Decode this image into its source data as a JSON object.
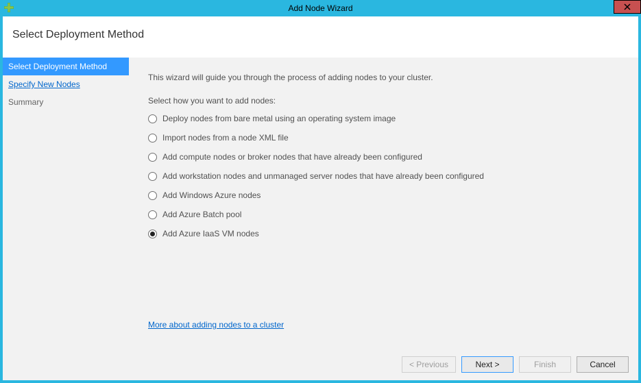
{
  "window": {
    "title": "Add Node Wizard"
  },
  "header": {
    "title": "Select Deployment Method"
  },
  "sidebar": {
    "items": [
      {
        "label": "Select Deployment Method",
        "state": "active"
      },
      {
        "label": "Specify New Nodes",
        "state": "link"
      },
      {
        "label": "Summary",
        "state": "normal"
      }
    ]
  },
  "content": {
    "intro": "This wizard will guide you through the process of adding nodes to your cluster.",
    "prompt": "Select how you want to add nodes:",
    "options": [
      {
        "label": "Deploy nodes from bare metal using an operating system image",
        "selected": false
      },
      {
        "label": "Import nodes from a node XML file",
        "selected": false
      },
      {
        "label": "Add compute nodes or broker nodes that have already been configured",
        "selected": false
      },
      {
        "label": "Add workstation nodes and unmanaged server nodes that have already been configured",
        "selected": false
      },
      {
        "label": "Add Windows Azure nodes",
        "selected": false
      },
      {
        "label": "Add Azure Batch pool",
        "selected": false
      },
      {
        "label": "Add Azure IaaS VM nodes",
        "selected": true
      }
    ],
    "help_link": "More about adding nodes to a cluster"
  },
  "footer": {
    "previous": "< Previous",
    "next": "Next >",
    "finish": "Finish",
    "cancel": "Cancel"
  }
}
